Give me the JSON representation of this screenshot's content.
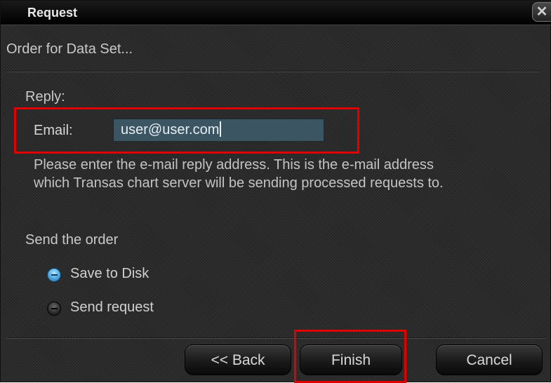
{
  "window": {
    "title": "Request",
    "close_glyph": "✕"
  },
  "header": {
    "subtitle": "Order for Data Set..."
  },
  "reply": {
    "section_label": "Reply:",
    "email_label": "Email:",
    "email_value": "user@user.com",
    "help_line1": "Please enter the e-mail reply address. This is the e-mail address",
    "help_line2": "which Transas chart server will be sending processed requests to."
  },
  "send": {
    "section_label": "Send the order",
    "options": [
      {
        "label": "Save to Disk",
        "selected": true
      },
      {
        "label": "Send request",
        "selected": false
      }
    ]
  },
  "buttons": {
    "back": "<< Back",
    "finish": "Finish",
    "cancel": "Cancel"
  },
  "colors": {
    "highlight": "#e00000",
    "input_bg": "#3c5563",
    "radio_selected": "#5fb6ea"
  }
}
